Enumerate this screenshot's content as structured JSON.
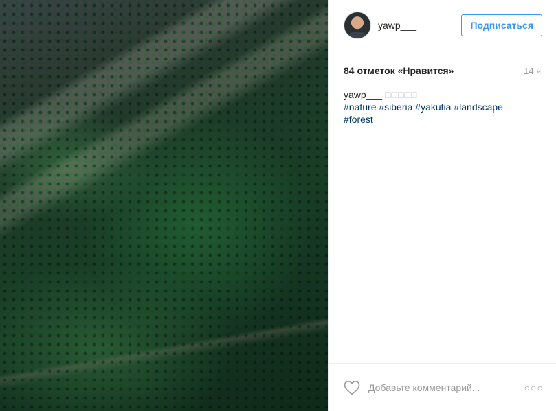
{
  "post": {
    "image_alt": "aerial forest",
    "author": {
      "username": "yawp___"
    },
    "follow_label": "Подписаться",
    "likes_text": "84 отметок «Нравится»",
    "time_text": "14 ч",
    "caption": {
      "username": "yawp___",
      "emoji": "□□□□□",
      "tags": [
        "#nature",
        "#siberia",
        "#yakutia",
        "#landscape",
        "#forest"
      ]
    },
    "comment_placeholder": "Добавьте комментарий...",
    "more_label": "○○○"
  },
  "colors": {
    "follow_blue": "#3897f0",
    "hashtag": "#003569",
    "muted": "#999999"
  },
  "icons": {
    "like": "heart-outline-icon",
    "more": "more-options-icon"
  }
}
